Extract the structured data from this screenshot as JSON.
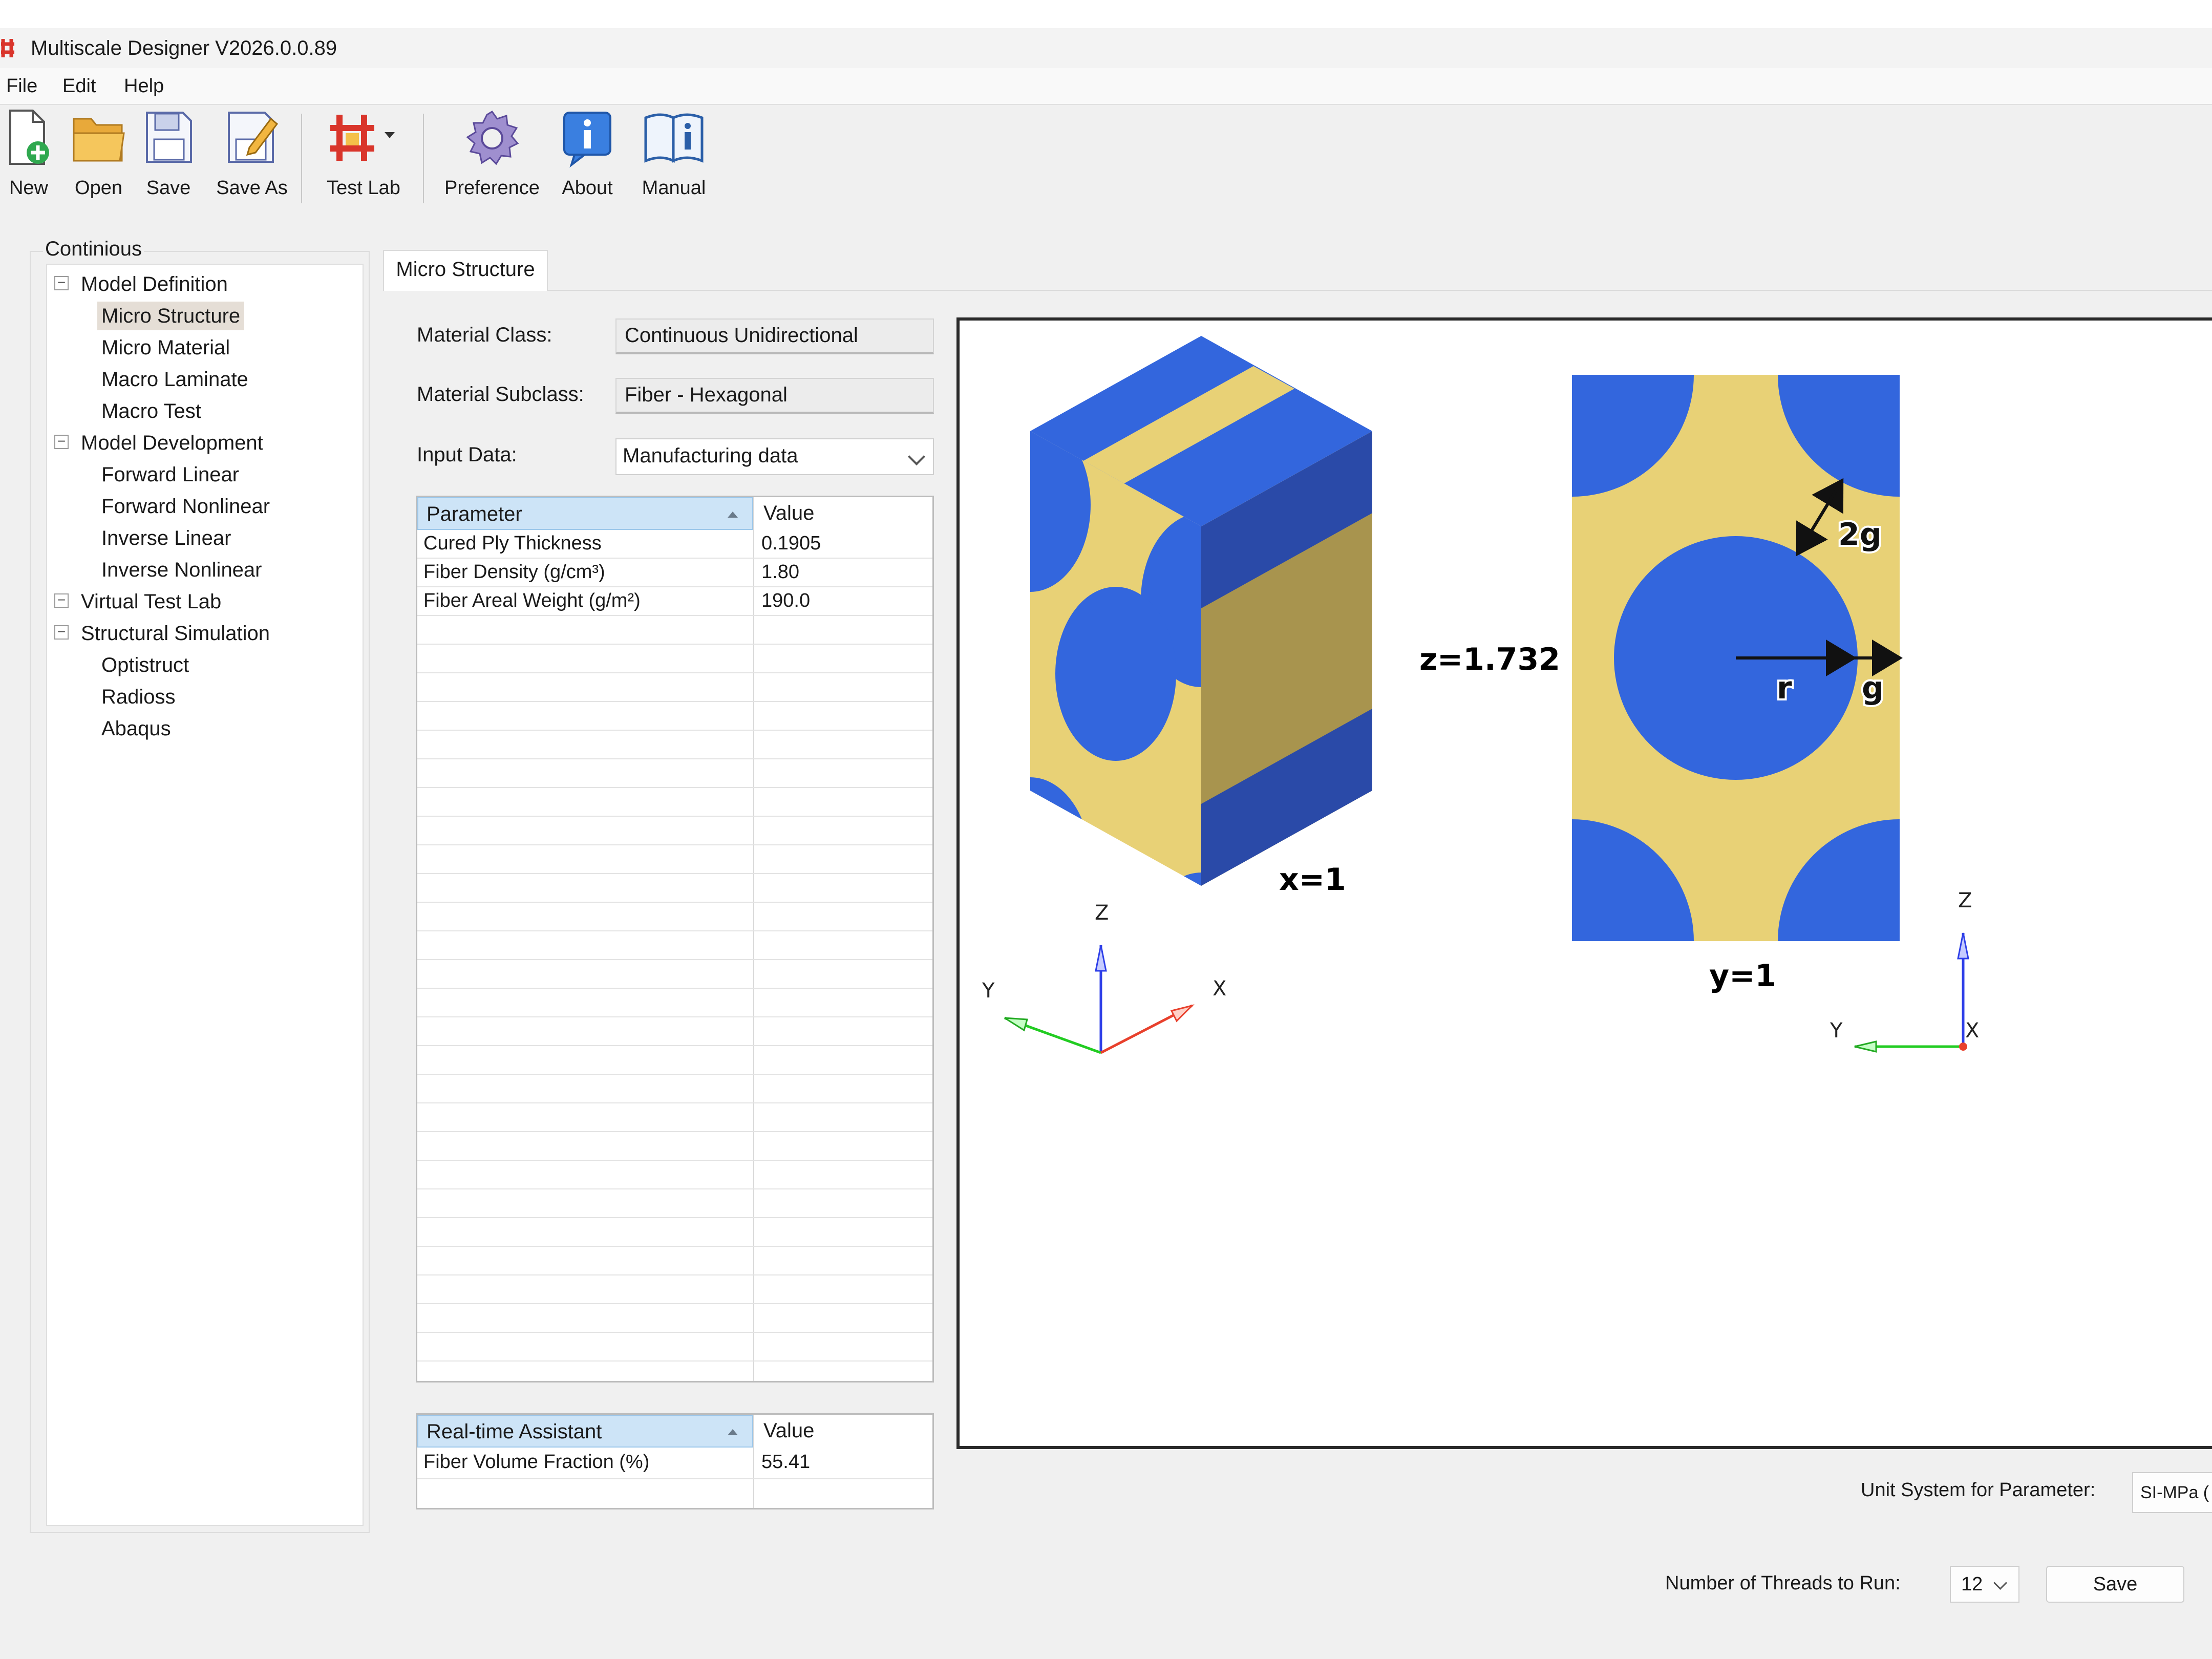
{
  "window": {
    "title": "Multiscale Designer V2026.0.0.89"
  },
  "menu": [
    "File",
    "Edit",
    "Help"
  ],
  "toolbar": {
    "new": "New",
    "open": "Open",
    "save": "Save",
    "save_as": "Save As",
    "test_lab": "Test Lab",
    "preference": "Preference",
    "about": "About",
    "manual": "Manual"
  },
  "tree": {
    "group_label": "Continious",
    "nodes": [
      {
        "label": "Model Definition",
        "children": [
          "Micro Structure",
          "Micro Material",
          "Macro Laminate",
          "Macro Test"
        ]
      },
      {
        "label": "Model Development",
        "children": [
          "Forward Linear",
          "Forward Nonlinear",
          "Inverse Linear",
          "Inverse Nonlinear"
        ]
      },
      {
        "label": "Virtual Test Lab",
        "children": []
      },
      {
        "label": "Structural Simulation",
        "children": [
          "Optistruct",
          "Radioss",
          "Abaqus"
        ]
      }
    ],
    "selected": "Micro Structure"
  },
  "tab": {
    "label": "Micro Structure"
  },
  "form": {
    "material_class_label": "Material Class:",
    "material_class_value": "Continuous Unidirectional",
    "material_subclass_label": "Material Subclass:",
    "material_subclass_value": "Fiber - Hexagonal",
    "input_data_label": "Input Data:",
    "input_data_value": "Manufacturing data"
  },
  "param_table": {
    "headers": [
      "Parameter",
      "Value"
    ],
    "rows": [
      [
        "Cured Ply Thickness",
        "0.1905"
      ],
      [
        "Fiber Density (g/cm³)",
        "1.80"
      ],
      [
        "Fiber Areal Weight (g/m²)",
        "190.0"
      ]
    ]
  },
  "assistant_table": {
    "headers": [
      "Real-time Assistant",
      "Value"
    ],
    "rows": [
      [
        "Fiber Volume Fraction (%)",
        "55.41"
      ]
    ]
  },
  "viewer": {
    "labels": {
      "x": "x=1",
      "y": "y=1",
      "z": "z=1.732",
      "two_g": "2g",
      "r": "r",
      "g": "g"
    },
    "axes_left": {
      "z": "Z",
      "y": "Y",
      "x": "X"
    },
    "axes_right": {
      "z": "Z",
      "y": "Y",
      "x": "X"
    },
    "colors": {
      "fiber": "#3366dd",
      "fiber_dark": "#2a4aa8",
      "matrix": "#e8d176",
      "matrix_dark": "#a8944e"
    }
  },
  "bottom": {
    "unit_label": "Unit System for Parameter:",
    "unit_value": "SI-MPa (",
    "threads_label": "Number of Threads to Run:",
    "threads_value": "12",
    "save_label": "Save"
  }
}
